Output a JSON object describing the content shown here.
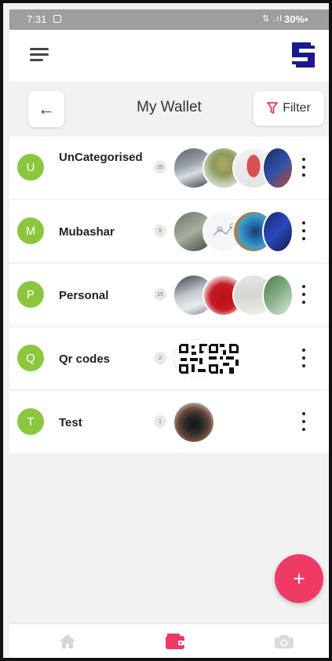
{
  "status_bar": {
    "time": "7:31",
    "signal": "⇅ .ıl",
    "battery": "30%▪"
  },
  "header": {
    "back_icon": "←",
    "title": "My Wallet",
    "filter_label": "Filter"
  },
  "wallets": [
    {
      "initial": "U",
      "name": "UnCategorised",
      "count": "25",
      "thumbs": [
        "photo-laptop",
        "photo-outdoor",
        "photo-person",
        "photo-screen"
      ]
    },
    {
      "initial": "M",
      "name": "Mubashar",
      "count": "9",
      "thumbs": [
        "photo-grey",
        "photo-diagram",
        "photo-blue-pattern",
        "photo-screen"
      ]
    },
    {
      "initial": "P",
      "name": "Personal",
      "count": "15",
      "thumbs": [
        "photo-table",
        "photo-red-shirt",
        "photo-paper",
        "photo-green"
      ]
    },
    {
      "initial": "Q",
      "name": "Qr codes",
      "count": "2",
      "thumbs": [
        "qr-code",
        "qr-code"
      ]
    },
    {
      "initial": "T",
      "name": "Test",
      "count": "1",
      "thumbs": [
        "photo-dark"
      ]
    }
  ],
  "fab": {
    "label": "+"
  },
  "colors": {
    "avatar": "#8cc63f",
    "accent": "#f03a66",
    "logo": "#1a1a8c",
    "filter_icon": "#e53950"
  },
  "bottom_nav": [
    {
      "icon": "home-icon",
      "active": false
    },
    {
      "icon": "wallet-icon",
      "active": true
    },
    {
      "icon": "camera-icon",
      "active": false
    }
  ]
}
